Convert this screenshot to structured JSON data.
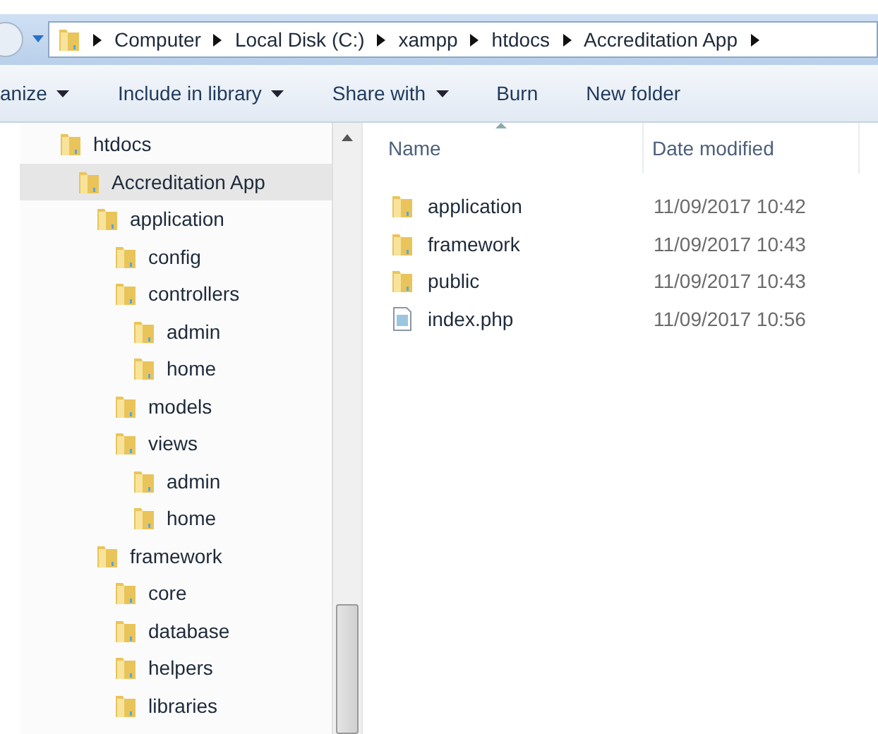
{
  "address_bar": {
    "segments": [
      "Computer",
      "Local Disk (C:)",
      "xampp",
      "htdocs",
      "Accreditation App"
    ]
  },
  "toolbar": [
    {
      "label": "anize",
      "has_menu": true
    },
    {
      "label": "Include in library",
      "has_menu": true
    },
    {
      "label": "Share with",
      "has_menu": true
    },
    {
      "label": "Burn",
      "has_menu": false
    },
    {
      "label": "New folder",
      "has_menu": false
    }
  ],
  "tree": [
    {
      "label": "htdocs",
      "selected": false,
      "children": [
        {
          "label": "Accreditation App",
          "selected": true,
          "children": [
            {
              "label": "application",
              "selected": false,
              "children": [
                {
                  "label": "config",
                  "selected": false
                },
                {
                  "label": "controllers",
                  "selected": false,
                  "children": [
                    {
                      "label": "admin",
                      "selected": false
                    },
                    {
                      "label": "home",
                      "selected": false
                    }
                  ]
                },
                {
                  "label": "models",
                  "selected": false
                },
                {
                  "label": "views",
                  "selected": false,
                  "children": [
                    {
                      "label": "admin",
                      "selected": false
                    },
                    {
                      "label": "home",
                      "selected": false
                    }
                  ]
                }
              ]
            },
            {
              "label": "framework",
              "selected": false,
              "children": [
                {
                  "label": "core",
                  "selected": false
                },
                {
                  "label": "database",
                  "selected": false
                },
                {
                  "label": "helpers",
                  "selected": false
                },
                {
                  "label": "libraries",
                  "selected": false
                }
              ]
            }
          ]
        }
      ]
    }
  ],
  "file_list": {
    "columns": [
      "Name",
      "Date modified"
    ],
    "rows": [
      {
        "kind": "folder",
        "name": "application",
        "date": "11/09/2017 10:42"
      },
      {
        "kind": "folder",
        "name": "framework",
        "date": "11/09/2017 10:43"
      },
      {
        "kind": "folder",
        "name": "public",
        "date": "11/09/2017 10:43"
      },
      {
        "kind": "file",
        "name": "index.php",
        "date": "11/09/2017 10:56"
      }
    ]
  }
}
